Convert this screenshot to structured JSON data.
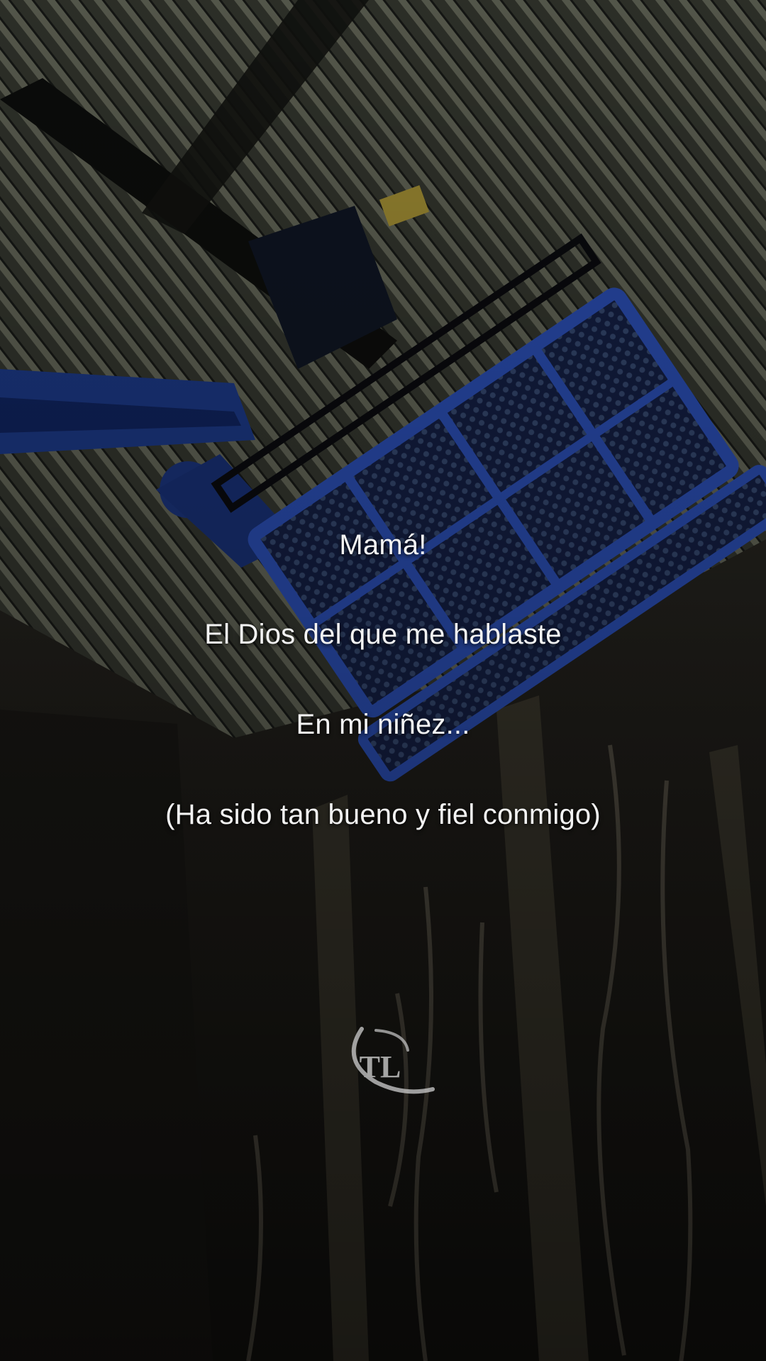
{
  "lyrics": [
    "Mamá!",
    "El Dios del que me hablaste",
    "En mi niñez...",
    "(Ha sido tan bueno y fiel conmigo)"
  ],
  "watermark": {
    "text": "TL",
    "icon": "tl-logo-icon"
  },
  "colors": {
    "text": "#f3f3f3",
    "basket_blue": "#2a4fb3",
    "background": "#0d0f12"
  }
}
